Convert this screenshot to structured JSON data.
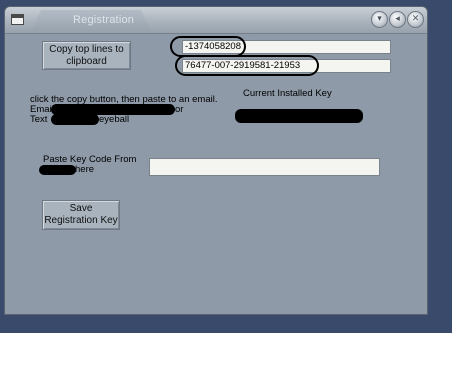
{
  "window": {
    "title": "Registration",
    "controls": [
      "▾",
      "◂",
      "✕"
    ]
  },
  "buttons": {
    "copy_label": "Copy top lines to clipboard",
    "save_label": "Save Registration Key"
  },
  "fields": {
    "top_line_1": "-1374058208",
    "top_line_2": "76477-007-2919581-21953",
    "paste_key": ""
  },
  "labels": {
    "instruction_1": "click the copy button, then paste  to an email.",
    "email_prefix": "Email t",
    "email_suffix": "or",
    "text_prefix": "Text",
    "text_suffix": "eyeball",
    "current_key_heading": "Current Installed Key",
    "paste_key_line1": "Paste Key Code From",
    "paste_key_line2": "here"
  }
}
